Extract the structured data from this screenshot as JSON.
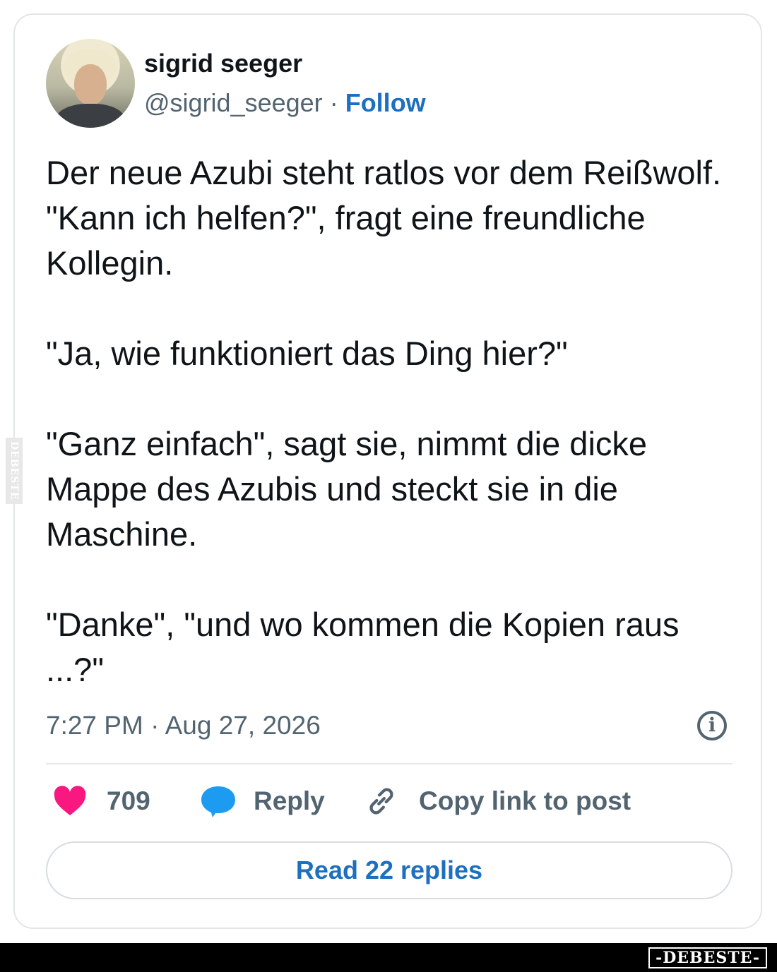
{
  "author": {
    "name": "sigrid seeger",
    "handle": "@sigrid_seeger",
    "separator": "·",
    "follow_label": "Follow"
  },
  "tweet": {
    "paragraphs": [
      "Der neue Azubi steht ratlos vor dem Reißwolf. \"Kann ich helfen?\", fragt eine freundliche Kollegin.",
      "\"Ja, wie funktioniert das Ding hier?\"",
      "\"Ganz einfach\", sagt sie, nimmt die dicke Mappe des Azubis und steckt sie in die Maschine.",
      "\"Danke\",  \"und wo kommen die Kopien raus ...?\""
    ],
    "timestamp": "7:27 PM · Aug 27, 2026"
  },
  "actions": {
    "likes": "709",
    "reply_label": "Reply",
    "copy_label": "Copy link to post"
  },
  "read_replies_label": "Read 22 replies",
  "watermark": {
    "side_text": "DEBESTE",
    "footer_logo": "-DEBESTE-"
  },
  "colors": {
    "accent": "#1d6fbf",
    "heart": "#f91880",
    "reply_bubble": "#1d9bf0",
    "muted": "#536471"
  },
  "icons": [
    "heart-icon",
    "speech-bubble-icon",
    "link-icon",
    "info-icon"
  ]
}
